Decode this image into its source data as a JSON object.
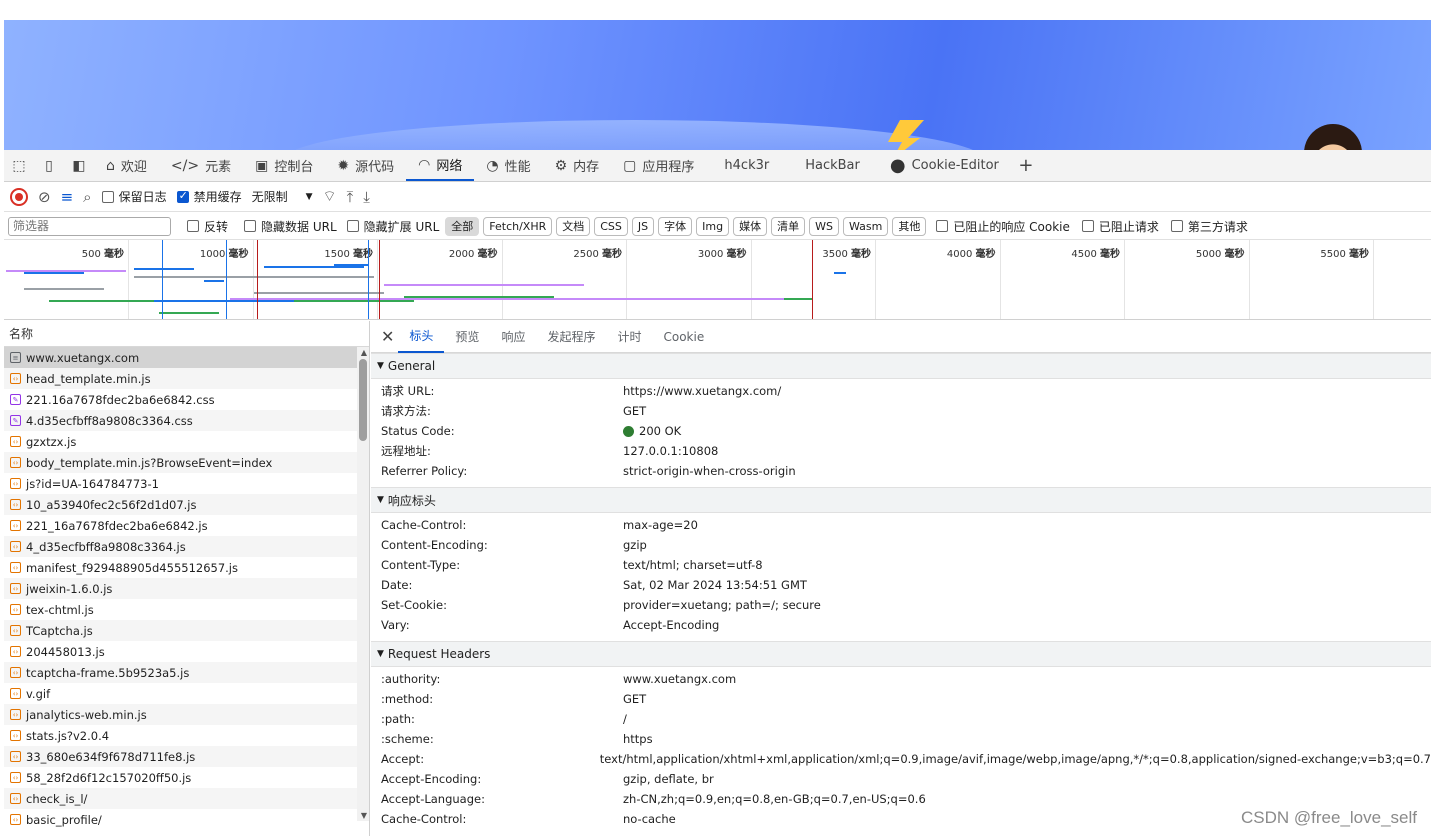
{
  "devtools_tabs": [
    {
      "label": "欢迎",
      "icon": "home-icon"
    },
    {
      "label": "元素",
      "icon": "code-icon"
    },
    {
      "label": "控制台",
      "icon": "console-icon"
    },
    {
      "label": "源代码",
      "icon": "bug-icon"
    },
    {
      "label": "网络",
      "icon": "wifi-icon",
      "active": true
    },
    {
      "label": "性能",
      "icon": "gauge-icon"
    },
    {
      "label": "内存",
      "icon": "memory-icon"
    },
    {
      "label": "应用程序",
      "icon": "app-icon"
    },
    {
      "label": "h4ck3r"
    },
    {
      "label": "HackBar"
    },
    {
      "label": "Cookie-Editor",
      "icon": "cookie-icon"
    }
  ],
  "toolbar": {
    "preserve_log": "保留日志",
    "disable_cache": "禁用缓存",
    "throttle": "无限制"
  },
  "filter": {
    "placeholder": "筛选器",
    "invert": "反转",
    "hide_data_url": "隐藏数据 URL",
    "hide_ext_url": "隐藏扩展 URL",
    "types": [
      "全部",
      "Fetch/XHR",
      "文档",
      "CSS",
      "JS",
      "字体",
      "Img",
      "媒体",
      "清单",
      "WS",
      "Wasm",
      "其他"
    ],
    "blocked_cookies": "已阻止的响应 Cookie",
    "blocked_requests": "已阻止请求",
    "third_party": "第三方请求"
  },
  "overview": {
    "ticks": [
      "500",
      "1000",
      "1500",
      "2000",
      "2500",
      "3000",
      "3500",
      "4000",
      "4500",
      "5000",
      "5500"
    ],
    "unit": "毫秒"
  },
  "request_list": {
    "header": "名称",
    "rows": [
      {
        "name": "www.xuetangx.com",
        "type": "doc",
        "selected": true
      },
      {
        "name": "head_template.min.js",
        "type": "js"
      },
      {
        "name": "221.16a7678fdec2ba6e6842.css",
        "type": "css"
      },
      {
        "name": "4.d35ecfbff8a9808c3364.css",
        "type": "css"
      },
      {
        "name": "gzxtzx.js",
        "type": "js"
      },
      {
        "name": "body_template.min.js?BrowseEvent=index",
        "type": "js"
      },
      {
        "name": "js?id=UA-164784773-1",
        "type": "js"
      },
      {
        "name": "10_a53940fec2c56f2d1d07.js",
        "type": "js"
      },
      {
        "name": "221_16a7678fdec2ba6e6842.js",
        "type": "js"
      },
      {
        "name": "4_d35ecfbff8a9808c3364.js",
        "type": "js"
      },
      {
        "name": "manifest_f929488905d455512657.js",
        "type": "js"
      },
      {
        "name": "jweixin-1.6.0.js",
        "type": "js"
      },
      {
        "name": "tex-chtml.js",
        "type": "js"
      },
      {
        "name": "TCaptcha.js",
        "type": "js"
      },
      {
        "name": "204458013.js",
        "type": "js"
      },
      {
        "name": "tcaptcha-frame.5b9523a5.js",
        "type": "js"
      },
      {
        "name": "v.gif",
        "type": "img"
      },
      {
        "name": "janalytics-web.min.js",
        "type": "js"
      },
      {
        "name": "stats.js?v2.0.4",
        "type": "js"
      },
      {
        "name": "33_680e634f9f678d711fe8.js",
        "type": "js"
      },
      {
        "name": "58_28f2d6f12c157020ff50.js",
        "type": "js"
      },
      {
        "name": "check_is_l/",
        "type": "js"
      },
      {
        "name": "basic_profile/",
        "type": "js"
      }
    ]
  },
  "detail_tabs": [
    "标头",
    "预览",
    "响应",
    "发起程序",
    "计时",
    "Cookie"
  ],
  "sections": [
    {
      "title": "General",
      "rows": [
        {
          "k": "请求 URL:",
          "v": "https://www.xuetangx.com/"
        },
        {
          "k": "请求方法:",
          "v": "GET"
        },
        {
          "k": "Status Code:",
          "v": "200 OK",
          "status": true
        },
        {
          "k": "远程地址:",
          "v": "127.0.0.1:10808"
        },
        {
          "k": "Referrer Policy:",
          "v": "strict-origin-when-cross-origin"
        }
      ]
    },
    {
      "title": "响应标头",
      "rows": [
        {
          "k": "Cache-Control:",
          "v": "max-age=20"
        },
        {
          "k": "Content-Encoding:",
          "v": "gzip"
        },
        {
          "k": "Content-Type:",
          "v": "text/html; charset=utf-8"
        },
        {
          "k": "Date:",
          "v": "Sat, 02 Mar 2024 13:54:51 GMT"
        },
        {
          "k": "Set-Cookie:",
          "v": "provider=xuetang; path=/; secure"
        },
        {
          "k": "Vary:",
          "v": "Accept-Encoding"
        }
      ]
    },
    {
      "title": "Request Headers",
      "rows": [
        {
          "k": ":authority:",
          "v": "www.xuetangx.com"
        },
        {
          "k": ":method:",
          "v": "GET"
        },
        {
          "k": ":path:",
          "v": "/"
        },
        {
          "k": ":scheme:",
          "v": "https"
        },
        {
          "k": "Accept:",
          "v": "text/html,application/xhtml+xml,application/xml;q=0.9,image/avif,image/webp,image/apng,*/*;q=0.8,application/signed-exchange;v=b3;q=0.7"
        },
        {
          "k": "Accept-Encoding:",
          "v": "gzip, deflate, br"
        },
        {
          "k": "Accept-Language:",
          "v": "zh-CN,zh;q=0.9,en;q=0.8,en-GB;q=0.7,en-US;q=0.6"
        },
        {
          "k": "Cache-Control:",
          "v": "no-cache"
        }
      ]
    }
  ],
  "watermark": "CSDN @free_love_self",
  "colors": {
    "accent": "#0b57d0",
    "record": "#d93025",
    "status_ok": "#2e7d32",
    "js_icon": "#e37400",
    "css_icon": "#9334e6"
  }
}
